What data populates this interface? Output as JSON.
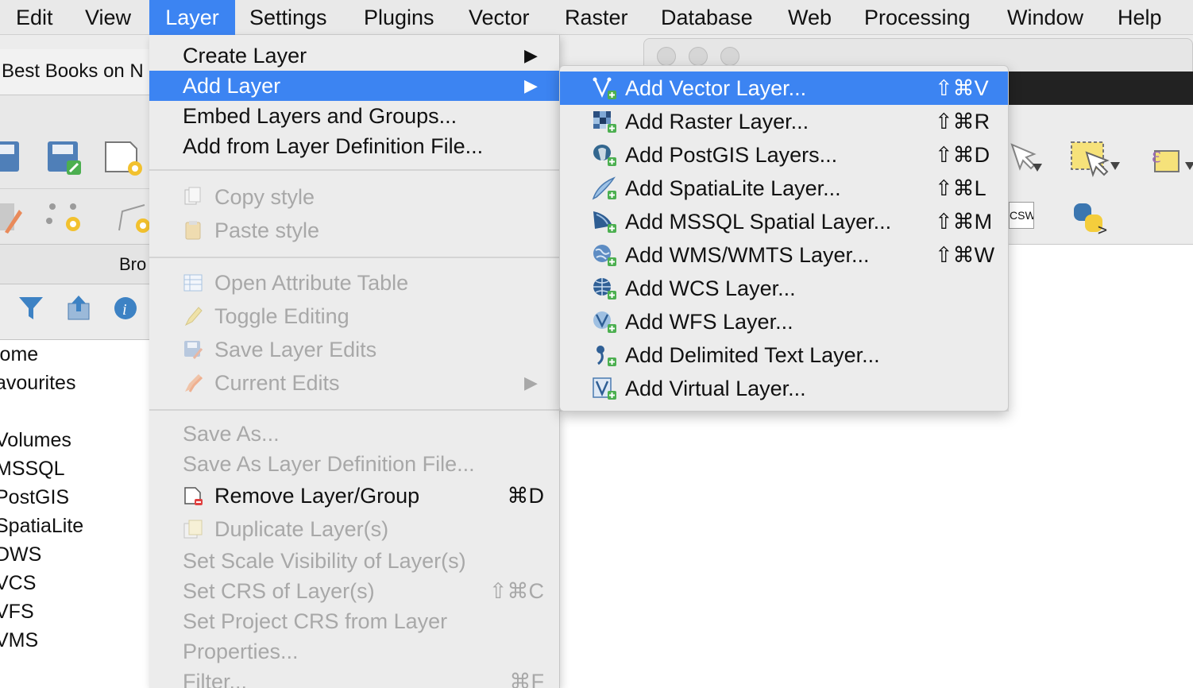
{
  "menubar": {
    "items": [
      "Edit",
      "View",
      "Layer",
      "Settings",
      "Plugins",
      "Vector",
      "Raster",
      "Database",
      "Web",
      "Processing",
      "Window",
      "Help"
    ],
    "active": "Layer"
  },
  "background": {
    "tab_title": "Best Books on N",
    "browser_header": "Bro",
    "browser_items": [
      "lome",
      "avourites",
      "Volumes",
      "MSSQL",
      "PostGIS",
      "SpatiaLite",
      "DWS",
      "VCS",
      "VFS",
      "VMS"
    ],
    "csw_label": "CSW"
  },
  "layer_menu": {
    "create_layer": "Create Layer",
    "add_layer": "Add Layer",
    "embed_layers": "Embed Layers and Groups...",
    "add_from_definition": "Add from Layer Definition File...",
    "copy_style": "Copy style",
    "paste_style": "Paste style",
    "open_attribute_table": "Open Attribute Table",
    "toggle_editing": "Toggle Editing",
    "save_layer_edits": "Save Layer Edits",
    "current_edits": "Current Edits",
    "save_as": "Save As...",
    "save_as_definition": "Save As Layer Definition File...",
    "remove_layer_group": "Remove Layer/Group",
    "remove_shortcut": "⌘D",
    "duplicate_layers": "Duplicate Layer(s)",
    "set_scale_visibility": "Set Scale Visibility of Layer(s)",
    "set_crs": "Set CRS of Layer(s)",
    "set_crs_shortcut": "⇧⌘C",
    "set_project_crs": "Set Project CRS from Layer",
    "properties": "Properties...",
    "filter": "Filter...",
    "filter_shortcut": "⌘F"
  },
  "add_layer_submenu": {
    "items": [
      {
        "label": "Add Vector Layer...",
        "shortcut": "⇧⌘V",
        "icon": "vector-layer-icon"
      },
      {
        "label": "Add Raster Layer...",
        "shortcut": "⇧⌘R",
        "icon": "raster-layer-icon"
      },
      {
        "label": "Add PostGIS Layers...",
        "shortcut": "⇧⌘D",
        "icon": "postgis-icon"
      },
      {
        "label": "Add SpatiaLite Layer...",
        "shortcut": "⇧⌘L",
        "icon": "spatialite-icon"
      },
      {
        "label": "Add MSSQL Spatial Layer...",
        "shortcut": "⇧⌘M",
        "icon": "mssql-icon"
      },
      {
        "label": "Add WMS/WMTS Layer...",
        "shortcut": "⇧⌘W",
        "icon": "wms-icon"
      },
      {
        "label": "Add WCS Layer...",
        "shortcut": "",
        "icon": "wcs-icon"
      },
      {
        "label": "Add WFS Layer...",
        "shortcut": "",
        "icon": "wfs-icon"
      },
      {
        "label": "Add Delimited Text Layer...",
        "shortcut": "",
        "icon": "delimited-text-icon"
      },
      {
        "label": "Add Virtual Layer...",
        "shortcut": "",
        "icon": "virtual-layer-icon"
      }
    ]
  },
  "colors": {
    "highlight": "#3c84f2",
    "menu_bg": "#ececec",
    "disabled_text": "#a8a8a8"
  }
}
